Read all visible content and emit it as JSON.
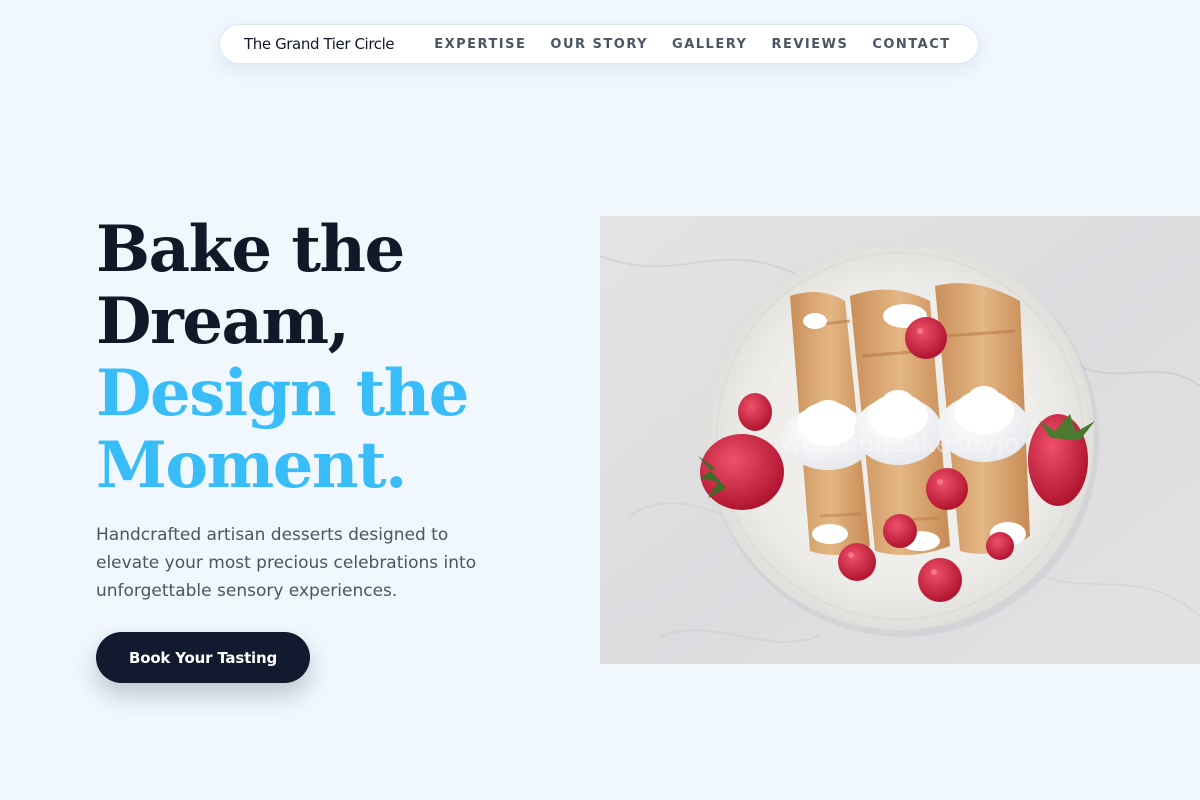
{
  "nav": {
    "brand": "The Grand Tier Circle",
    "links": [
      {
        "label": "EXPERTISE"
      },
      {
        "label": "OUR STORY"
      },
      {
        "label": "GALLERY"
      },
      {
        "label": "REVIEWS"
      },
      {
        "label": "CONTACT"
      }
    ]
  },
  "hero": {
    "title_lines": [
      "Bake the",
      "Dream,",
      "Design the",
      "Moment."
    ],
    "description": "Handcrafted artisan desserts designed to elevate your most precious celebrations into unforgettable sensory experiences.",
    "cta_label": "Book Your Tasting",
    "image": {
      "subject": "plate of rolled crêpes topped with whipped cream, strawberries and raspberries on a marble surface",
      "watermark": "weddingcakesbyjo"
    }
  },
  "colors": {
    "background": "#f0f7fd",
    "heading": "#111827",
    "accent": "#38bdf8",
    "button": "#111a2e",
    "body_text": "#4b5563"
  }
}
